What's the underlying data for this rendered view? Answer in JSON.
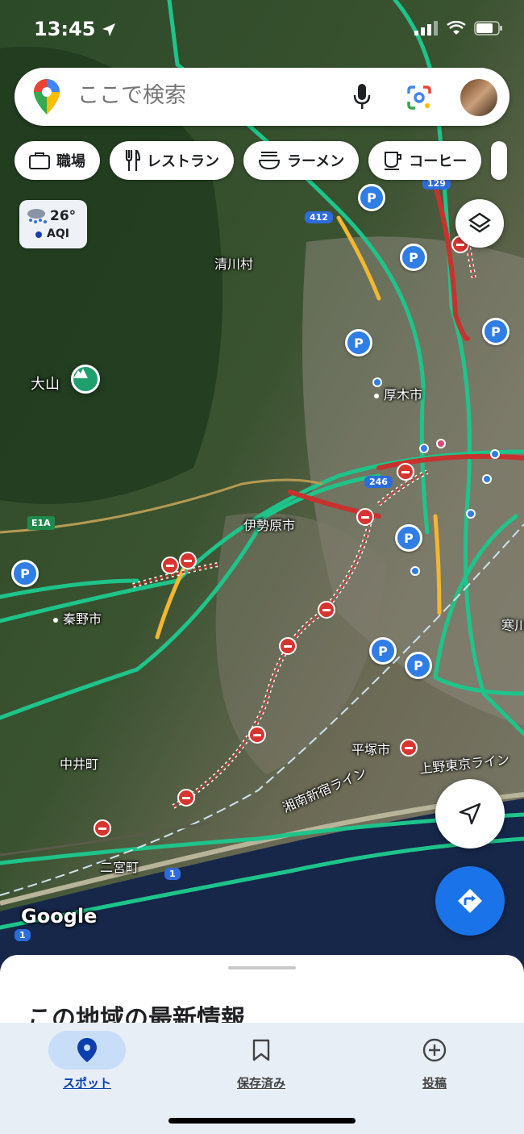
{
  "status": {
    "time": "13:45"
  },
  "search": {
    "placeholder": "ここで検索"
  },
  "chips": [
    {
      "label": "職場",
      "icon": "briefcase-icon"
    },
    {
      "label": "レストラン",
      "icon": "fork-knife-icon"
    },
    {
      "label": "ラーメン",
      "icon": "ramen-bowl-icon"
    },
    {
      "label": "コーヒー",
      "icon": "coffee-cup-icon"
    }
  ],
  "weather": {
    "temp": "26°",
    "aqi": "AQI"
  },
  "map_labels": {
    "kiyokawa": "清川村",
    "oyama": "大山",
    "atsugi": "厚木市",
    "isehara": "伊勢原市",
    "hadano": "秦野市",
    "nakai": "中井町",
    "ninomiya": "二宮町",
    "hiratsuka": "平塚市",
    "samukawa": "寒川",
    "ueno_tokyo_line": "上野東京ライン",
    "shonan_shinjuku_line": "湘南新宿ライン",
    "google": "Google"
  },
  "shields": {
    "r412": "412",
    "r129": "129",
    "r246": "246",
    "r1a": "1",
    "r1b": "1",
    "e1a": "E1A"
  },
  "sheet": {
    "title": "この地域の最新情報"
  },
  "nav": [
    {
      "label": "スポット",
      "icon": "location-pin-icon",
      "active": true
    },
    {
      "label": "保存済み",
      "icon": "bookmark-icon",
      "active": false
    },
    {
      "label": "投稿",
      "icon": "add-circle-icon",
      "active": false
    }
  ],
  "colors": {
    "accent": "#1a73e8",
    "traffic_green": "#1ec48a",
    "traffic_red": "#c8322e",
    "traffic_yellow": "#f2b731"
  }
}
